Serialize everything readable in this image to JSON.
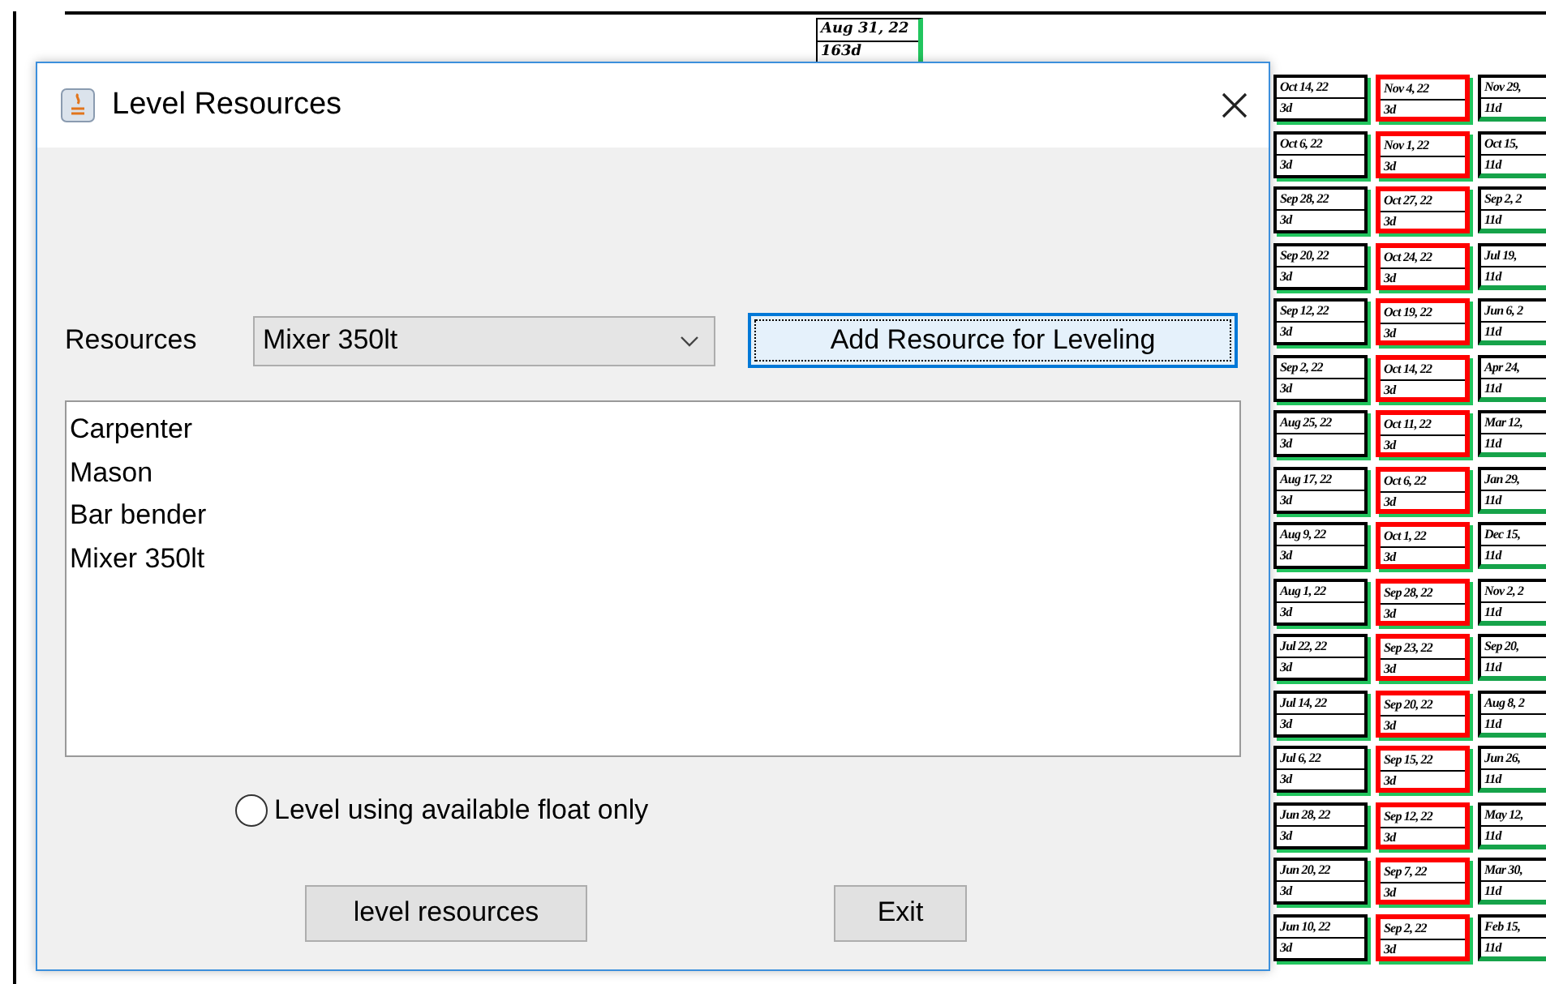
{
  "diagram": {
    "top_node": {
      "date": "Aug 31, 22",
      "duration": "163d"
    },
    "columns": [
      {
        "kind": "normal",
        "nodes": [
          {
            "date": "Oct 14, 22",
            "duration": "3d"
          },
          {
            "date": "Oct 6, 22",
            "duration": "3d"
          },
          {
            "date": "Sep 28, 22",
            "duration": "3d"
          },
          {
            "date": "Sep 20, 22",
            "duration": "3d"
          },
          {
            "date": "Sep 12, 22",
            "duration": "3d"
          },
          {
            "date": "Sep 2, 22",
            "duration": "3d"
          },
          {
            "date": "Aug 25, 22",
            "duration": "3d"
          },
          {
            "date": "Aug 17, 22",
            "duration": "3d"
          },
          {
            "date": "Aug 9, 22",
            "duration": "3d"
          },
          {
            "date": "Aug 1, 22",
            "duration": "3d"
          },
          {
            "date": "Jul 22, 22",
            "duration": "3d"
          },
          {
            "date": "Jul 14, 22",
            "duration": "3d"
          },
          {
            "date": "Jul 6, 22",
            "duration": "3d"
          },
          {
            "date": "Jun 28, 22",
            "duration": "3d"
          },
          {
            "date": "Jun 20, 22",
            "duration": "3d"
          },
          {
            "date": "Jun 10, 22",
            "duration": "3d"
          }
        ]
      },
      {
        "kind": "critical",
        "nodes": [
          {
            "date": "Nov 4, 22",
            "duration": "3d"
          },
          {
            "date": "Nov 1, 22",
            "duration": "3d"
          },
          {
            "date": "Oct 27, 22",
            "duration": "3d"
          },
          {
            "date": "Oct 24, 22",
            "duration": "3d"
          },
          {
            "date": "Oct 19, 22",
            "duration": "3d"
          },
          {
            "date": "Oct 14, 22",
            "duration": "3d"
          },
          {
            "date": "Oct 11, 22",
            "duration": "3d"
          },
          {
            "date": "Oct 6, 22",
            "duration": "3d"
          },
          {
            "date": "Oct 1, 22",
            "duration": "3d"
          },
          {
            "date": "Sep 28, 22",
            "duration": "3d"
          },
          {
            "date": "Sep 23, 22",
            "duration": "3d"
          },
          {
            "date": "Sep 20, 22",
            "duration": "3d"
          },
          {
            "date": "Sep 15, 22",
            "duration": "3d"
          },
          {
            "date": "Sep 12, 22",
            "duration": "3d"
          },
          {
            "date": "Sep 7, 22",
            "duration": "3d"
          },
          {
            "date": "Sep 2, 22",
            "duration": "3d"
          }
        ]
      },
      {
        "kind": "summary",
        "nodes": [
          {
            "date": "Nov 29,",
            "duration": "11d"
          },
          {
            "date": "Oct 15,",
            "duration": "11d"
          },
          {
            "date": "Sep 2, 2",
            "duration": "11d"
          },
          {
            "date": "Jul 19,",
            "duration": "11d"
          },
          {
            "date": "Jun 6, 2",
            "duration": "11d"
          },
          {
            "date": "Apr 24,",
            "duration": "11d"
          },
          {
            "date": "Mar 12,",
            "duration": "11d"
          },
          {
            "date": "Jan 29,",
            "duration": "11d"
          },
          {
            "date": "Dec 15,",
            "duration": "11d"
          },
          {
            "date": "Nov 2, 2",
            "duration": "11d"
          },
          {
            "date": "Sep 20,",
            "duration": "11d"
          },
          {
            "date": "Aug 8, 2",
            "duration": "11d"
          },
          {
            "date": "Jun 26,",
            "duration": "11d"
          },
          {
            "date": "May 12,",
            "duration": "11d"
          },
          {
            "date": "Mar 30,",
            "duration": "11d"
          },
          {
            "date": "Feb 15,",
            "duration": "11d"
          }
        ]
      }
    ]
  },
  "dialog": {
    "title": "Level Resources",
    "resources_label": "Resources",
    "resources_select": {
      "value": "Mixer 350lt"
    },
    "add_button": "Add Resource for Leveling",
    "resource_list": [
      "Carpenter",
      "Mason",
      "Bar bender",
      "Mixer 350lt"
    ],
    "float_option": {
      "label": "Level using available float only",
      "checked": false
    },
    "buttons": [
      "level resources",
      "Exit"
    ]
  }
}
